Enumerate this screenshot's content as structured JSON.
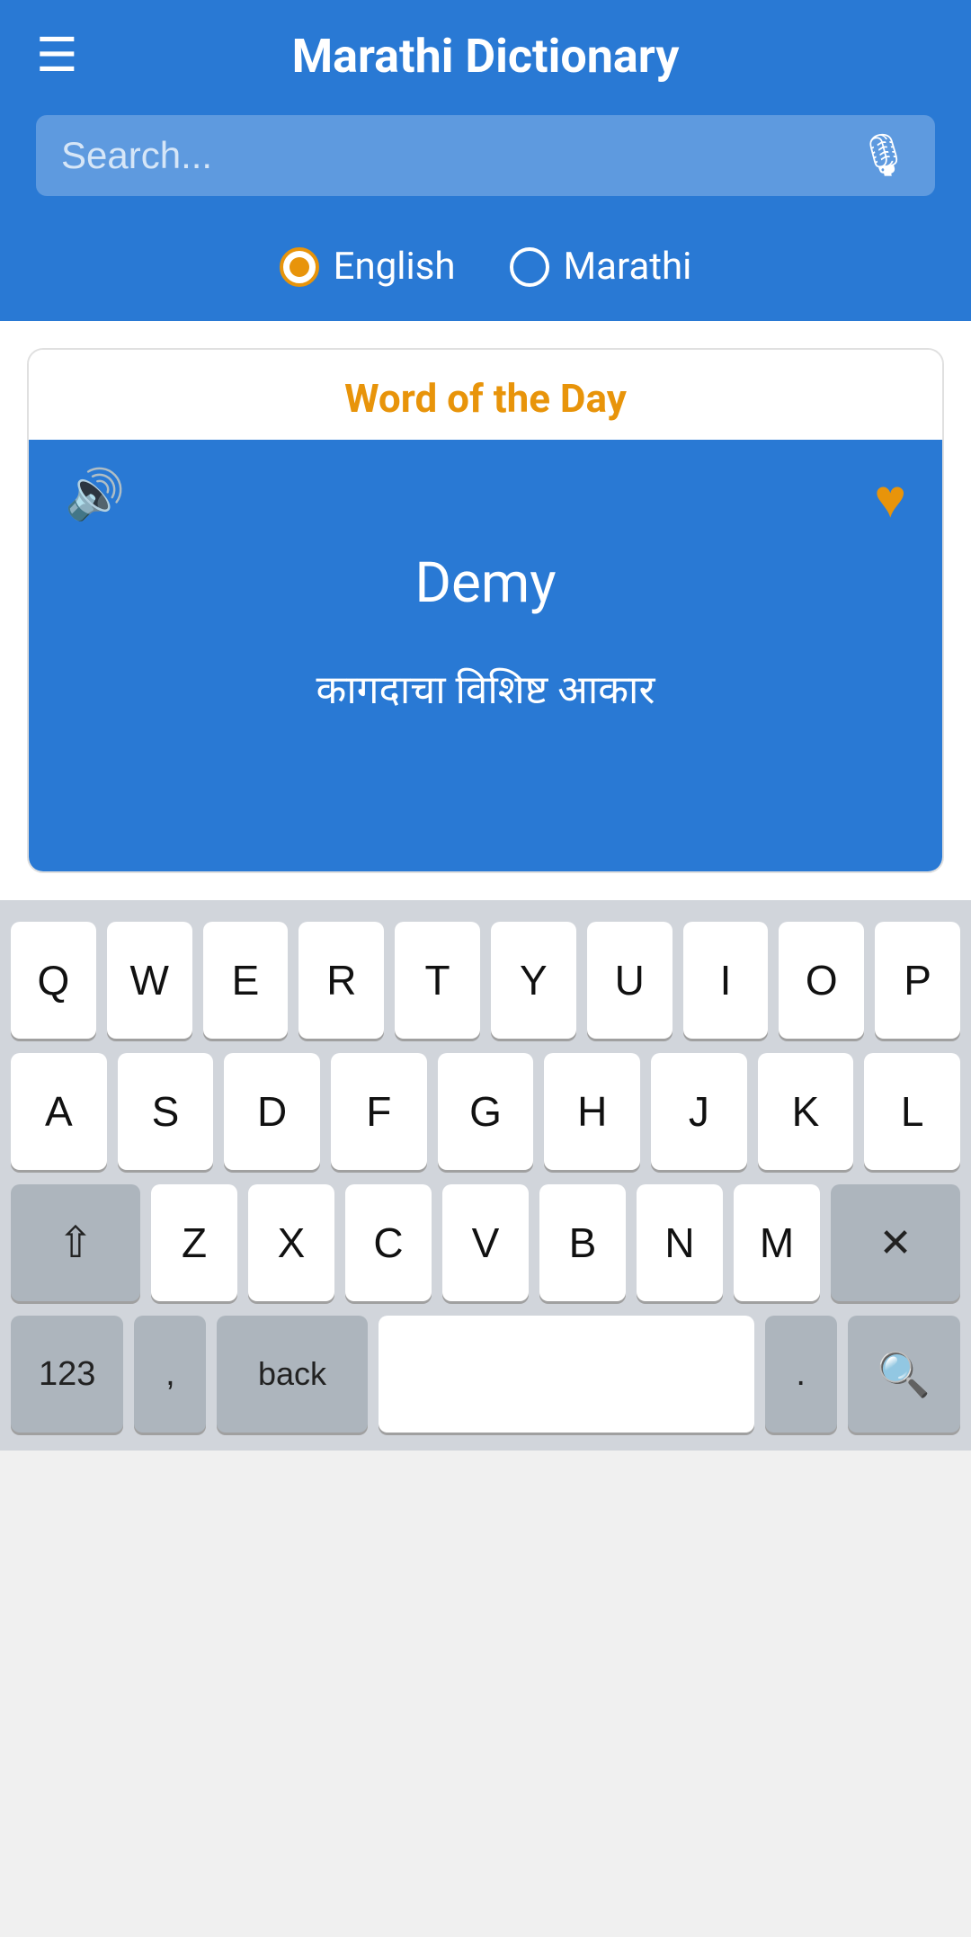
{
  "header": {
    "title": "Marathi Dictionary",
    "menu_icon": "☰"
  },
  "search": {
    "placeholder": "Search...",
    "mic_icon": "🎤"
  },
  "language_selector": {
    "options": [
      {
        "id": "english",
        "label": "English",
        "selected": true
      },
      {
        "id": "marathi",
        "label": "Marathi",
        "selected": false
      }
    ]
  },
  "word_of_day": {
    "section_title": "Word of the Day",
    "word": "Demy",
    "translation": "कागदाचा विशिष्ट आकार",
    "sound_icon": "🔊",
    "heart_icon": "♥"
  },
  "keyboard": {
    "row1": [
      "Q",
      "W",
      "E",
      "R",
      "T",
      "Y",
      "U",
      "I",
      "O",
      "P"
    ],
    "row2": [
      "A",
      "S",
      "D",
      "F",
      "G",
      "H",
      "J",
      "K",
      "L"
    ],
    "row3_special_left": "⇧",
    "row3": [
      "Z",
      "X",
      "C",
      "V",
      "B",
      "N",
      "M"
    ],
    "row3_special_right": "✕",
    "bottom": {
      "num_label": "123",
      "comma": ",",
      "back_label": "back",
      "space_label": "",
      "period": ".",
      "search_icon": "🔍"
    }
  },
  "colors": {
    "brand_blue": "#2979d4",
    "accent_orange": "#e8940a",
    "white": "#ffffff",
    "keyboard_bg": "#d1d5db",
    "key_bg": "#ffffff",
    "key_special_bg": "#adb5bd"
  }
}
